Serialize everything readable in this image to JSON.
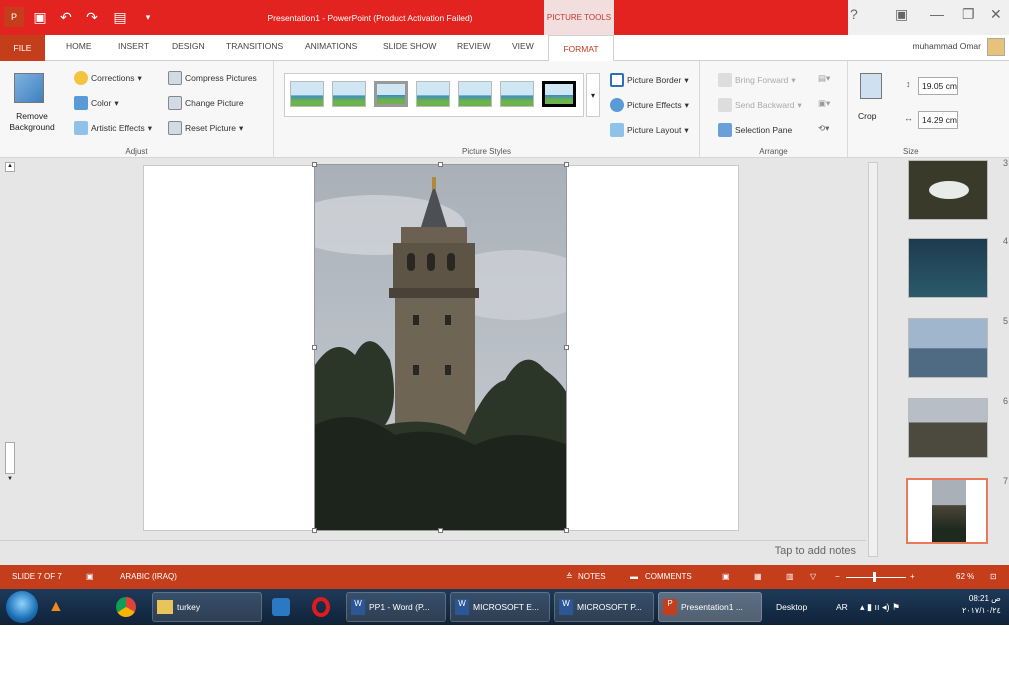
{
  "window": {
    "title": "Presentation1 -  PowerPoint (Product Activation Failed)",
    "context_tab": "PICTURE TOOLS",
    "help": "?",
    "restore": "—",
    "close": "✕"
  },
  "tabs": [
    "FILE",
    "HOME",
    "INSERT",
    "DESIGN",
    "TRANSITIONS",
    "ANIMATIONS",
    "SLIDE SHOW",
    "REVIEW",
    "VIEW",
    "FORMAT"
  ],
  "user": "muhammad Omar",
  "ribbon": {
    "adjust": {
      "remove_bg": "Remove Background",
      "corrections": "Corrections",
      "color": "Color",
      "artistic": "Artistic Effects",
      "compress": "Compress Pictures",
      "change": "Change Picture",
      "reset": "Reset Picture",
      "label": "Adjust"
    },
    "styles": {
      "label": "Picture Styles",
      "border": "Picture Border",
      "effects": "Picture Effects",
      "layout": "Picture Layout"
    },
    "arrange": {
      "label": "Arrange",
      "bring_forward": "Bring Forward",
      "send_backward": "Send Backward",
      "selection_pane": "Selection Pane"
    },
    "size": {
      "label": "Size",
      "crop": "Crop",
      "height": "19.05 cm",
      "width": "14.29 cm"
    }
  },
  "notes_placeholder": "Tap to add notes",
  "thumbnails": [
    "3",
    "4",
    "5",
    "6",
    "7"
  ],
  "status": {
    "slide": "SLIDE 7 OF 7",
    "language": "ARABIC (IRAQ)",
    "notes": "NOTES",
    "comments": "COMMENTS",
    "zoom": "62 %"
  },
  "taskbar": {
    "turkey": "turkey",
    "word1": "PP1 - Word (P...",
    "word2": "MICROSOFT E...",
    "word3": "MICROSOFT P...",
    "ppt": "Presentation1 ...",
    "desktop": "Desktop",
    "lang": "AR",
    "time": "08:21 ص",
    "date": "٢٠١٧/١٠/٢٤"
  },
  "colors": {
    "accent": "#c43e1c",
    "title_red": "#e3231f"
  }
}
